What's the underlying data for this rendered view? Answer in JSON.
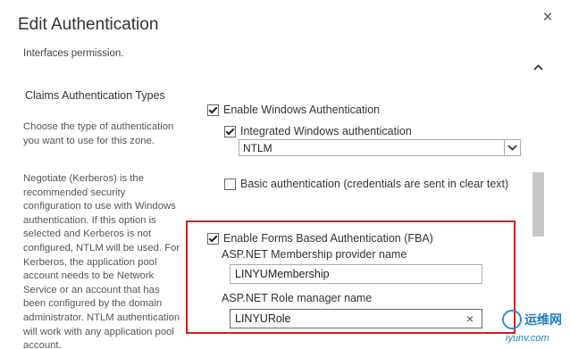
{
  "dialog": {
    "title": "Edit Authentication",
    "close_symbol": "×"
  },
  "content": {
    "intro_text": "Interfaces permission.",
    "section_heading": "Claims Authentication Types",
    "description_1": "Choose the type of authentication you want to use for this zone.",
    "description_2": "Negotiate (Kerberos) is the recommended security configuration to use with Windows authentication. If this option is selected and Kerberos is not configured, NTLM will be used. For Kerberos, the application pool account needs to be Network Service or an account that has been configured by the domain administrator. NTLM authentication will work with any application pool account."
  },
  "options": {
    "windows_auth": {
      "label": "Enable Windows Authentication",
      "checked": true
    },
    "integrated_windows": {
      "label": "Integrated Windows authentication",
      "checked": true
    },
    "integrated_mode": {
      "selected": "NTLM"
    },
    "basic_auth": {
      "label": "Basic authentication (credentials are sent in clear text)",
      "checked": false
    },
    "fba": {
      "label": "Enable Forms Based Authentication (FBA)",
      "checked": true
    }
  },
  "fba_fields": {
    "membership_label": "ASP.NET Membership provider name",
    "membership_value": "LINYUMembership",
    "role_label": "ASP.NET Role manager name",
    "role_value": "LINYURole",
    "clear_symbol": "×"
  },
  "watermark": {
    "brand": "运维网",
    "url": "iyunv.com"
  },
  "colors": {
    "highlight": "#cc2222",
    "watermark": "#1f7fc4"
  }
}
